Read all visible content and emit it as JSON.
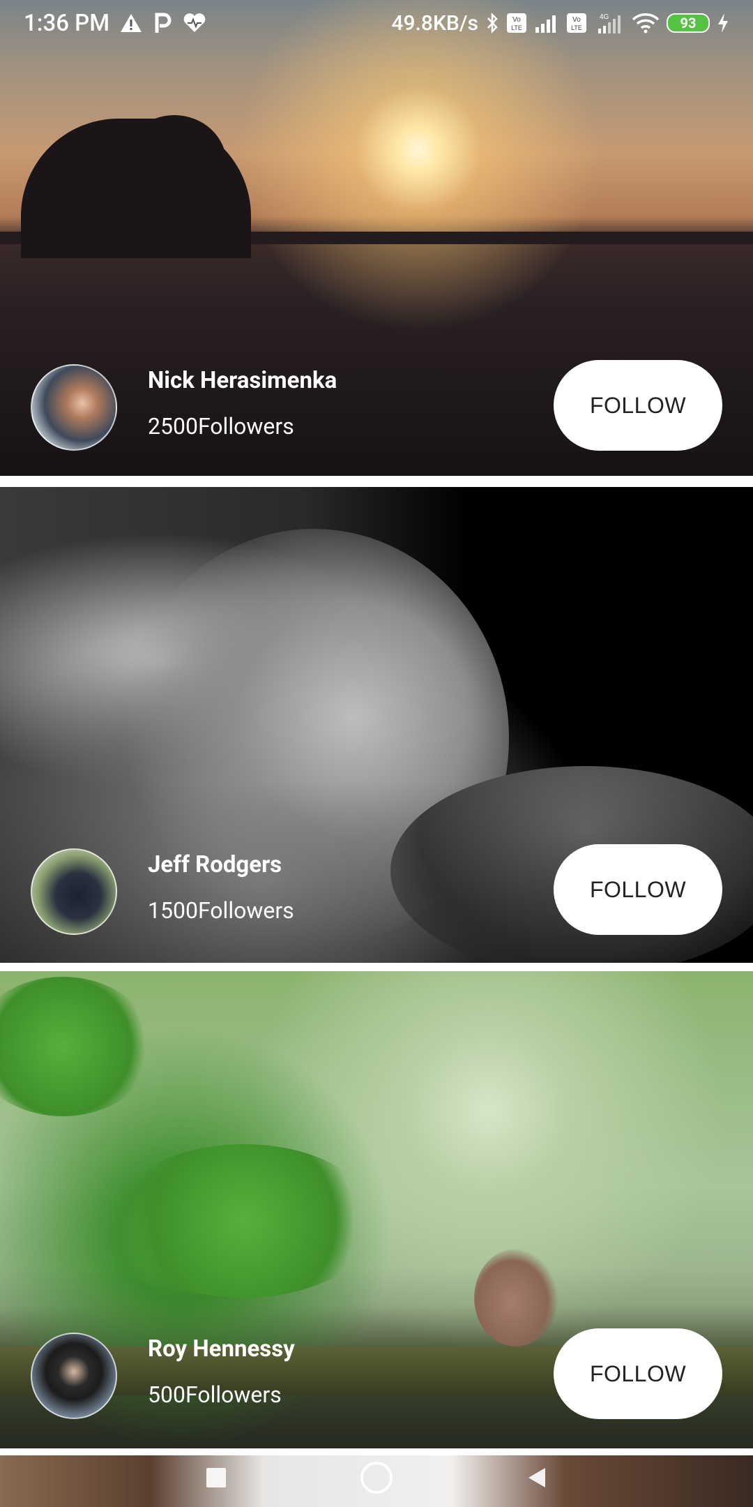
{
  "status_bar": {
    "time": "1:36 PM",
    "left_icons": [
      "warning-icon",
      "parking-icon",
      "heart-icon"
    ],
    "network_speed": "49.8KB/s",
    "right_icons": [
      "bluetooth-icon",
      "volte-icon",
      "signal-icon",
      "volte-icon",
      "4g-signal-icon",
      "wifi-icon"
    ],
    "battery_level": "93",
    "charging": true
  },
  "profiles": [
    {
      "name": "Nick Herasimenka",
      "followers": "2500Followers",
      "follow_label": "FOLLOW"
    },
    {
      "name": "Jeff Rodgers",
      "followers": "1500Followers",
      "follow_label": "FOLLOW"
    },
    {
      "name": "Roy Hennessy",
      "followers": "500Followers",
      "follow_label": "FOLLOW"
    }
  ],
  "nav_bar": {
    "buttons": [
      "recents-button",
      "home-button",
      "back-button"
    ]
  },
  "colors": {
    "button_bg": "#ffffff",
    "button_text": "#222222",
    "battery_green": "#55c244"
  }
}
